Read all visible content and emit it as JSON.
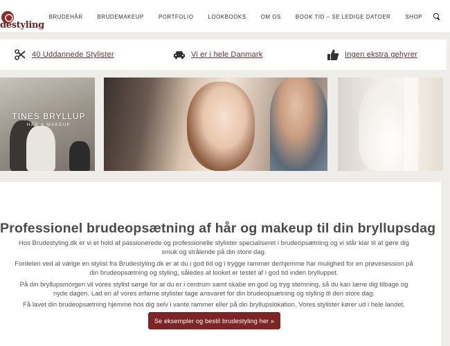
{
  "header": {
    "logo_text": "destyling",
    "nav": [
      {
        "label": "BRUDEHÅR"
      },
      {
        "label": "BRUDEMAKEUP"
      },
      {
        "label": "PORTFOLIO"
      },
      {
        "label": "LOOKBOOKS"
      },
      {
        "label": "OM OS"
      },
      {
        "label": "BOOK TID – SE LEDIGE DATOER"
      },
      {
        "label": "SHOP"
      }
    ]
  },
  "features": [
    {
      "icon": "scissors-icon",
      "label": "40 Uddannede Stylister"
    },
    {
      "icon": "car-icon",
      "label": "Vi er i hele Danmark"
    },
    {
      "icon": "thumbs-up-icon",
      "label": "Ingen ekstra gehyrer"
    }
  ],
  "gallery": {
    "left_overlay_title": "TINES BRYLLUP",
    "left_overlay_sub": "HÅR & MAKEUP"
  },
  "content": {
    "headline": "Professionel brudeopsætning af hår og makeup til din bryllupsdag",
    "paragraphs": [
      "Hos Brudestyling.dk er vi et hold af passionerede og professionelle stylister specialiseret i brudeopsætning og vi står klar til at gøre dig smuk og strålende på din store dag.",
      "Fordelen ved at vælge en stylist fra Brudestyling.dk er at du i god tid og i trygge rammer derhjemme har mulighed for en prøvesession på din brudeopsætning og styling, således at looket er testet af i god tid inden brylluppet.",
      "På din bryllupsmorgen vil vores stylist sørge for at du er i centrum samt skabe en god og tryg stemning, så du kan læne dig tilbage og nyde dagen. Lad en af vores erfarne stylister tage ansvaret for din brudeopsætning og styling til den store dag.",
      "Få lavet din brudeopsætning hjemme hos dig selv i vante rammer eller på din bryllupslokation. Vores stylister kører ud i hele landet."
    ],
    "cta_label": "Se eksempler og bestil brudestyling her »"
  },
  "colors": {
    "brand": "#7d2525",
    "link": "#6b3030",
    "background": "#efedea"
  }
}
